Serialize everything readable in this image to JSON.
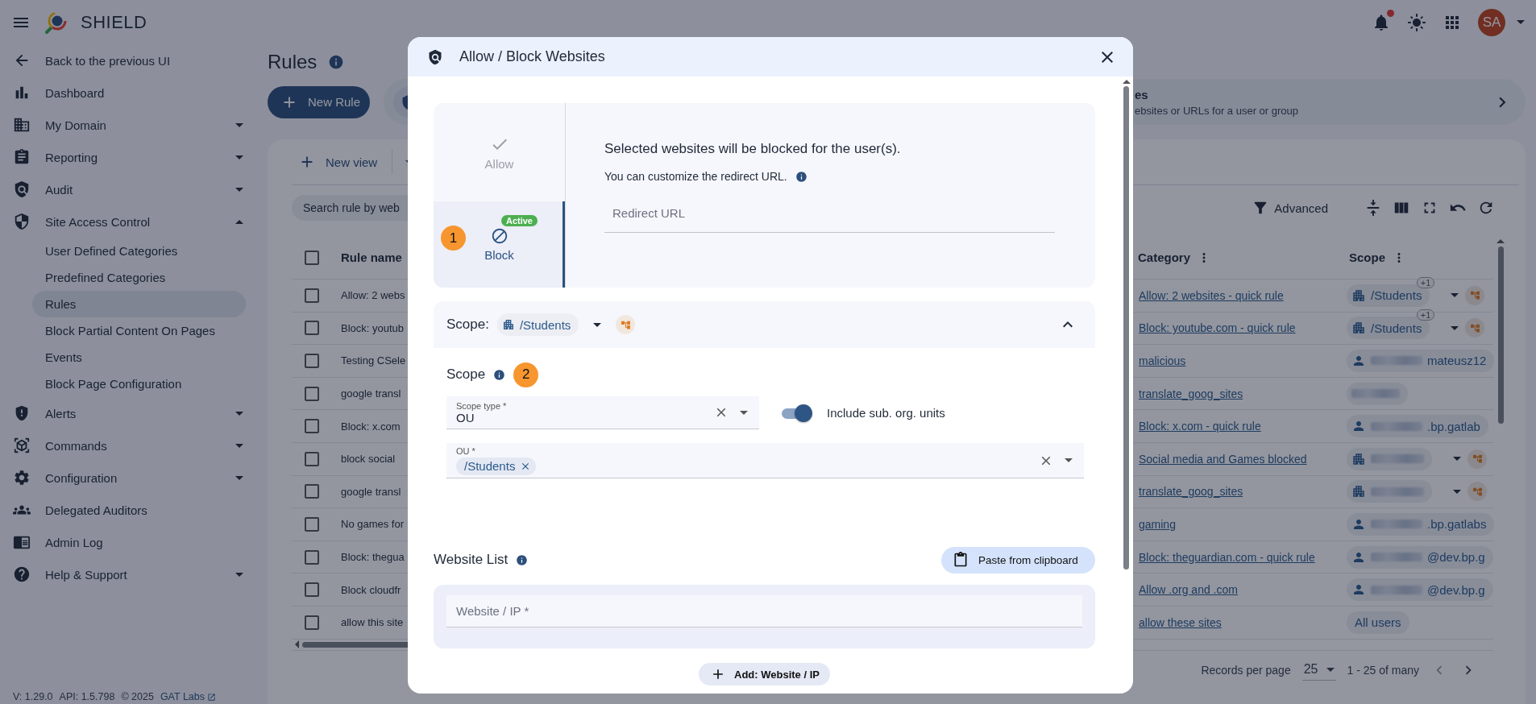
{
  "app": {
    "title": "SHIELD",
    "avatar": "SA",
    "has_notifications": true
  },
  "sidebar": {
    "items": [
      {
        "label": "Back to the previous UI"
      },
      {
        "label": "Dashboard"
      },
      {
        "label": "My Domain",
        "expanded": false
      },
      {
        "label": "Reporting",
        "expanded": false
      },
      {
        "label": "Audit",
        "expanded": false
      },
      {
        "label": "Site Access Control",
        "expanded": true,
        "children": [
          {
            "label": "User Defined Categories",
            "selected": false
          },
          {
            "label": "Predefined Categories",
            "selected": false
          },
          {
            "label": "Rules",
            "selected": true
          },
          {
            "label": "Block Partial Content On Pages",
            "selected": false
          },
          {
            "label": "Events",
            "selected": false
          },
          {
            "label": "Block Page Configuration",
            "selected": false
          }
        ]
      },
      {
        "label": "Alerts",
        "expanded": false
      },
      {
        "label": "Commands",
        "expanded": false
      },
      {
        "label": "Configuration",
        "expanded": false
      },
      {
        "label": "Delegated Auditors"
      },
      {
        "label": "Admin Log"
      },
      {
        "label": "Help & Support",
        "expanded": false
      }
    ],
    "footer": {
      "version": "V: 1.29.0",
      "api": "API: 1.5.798",
      "copyright": "© 2025",
      "link": "GAT Labs"
    }
  },
  "page": {
    "title": "Rules",
    "new_rule": "New Rule",
    "banner": {
      "title": "es",
      "subtitle": "ebsites or URLs for a user or group"
    }
  },
  "table": {
    "new_view": "New view",
    "search_placeholder": "Search rule by web",
    "advanced": "Advanced",
    "select_all_checked": false,
    "columns": [
      "Rule name",
      "Category",
      "Scope"
    ],
    "rows": [
      {
        "name": "Allow: 2 webs",
        "category": "Allow: 2 websites - quick rule",
        "checked": false,
        "scope": {
          "kind": "ou",
          "text": "/Students",
          "extra": "+1",
          "subunits": true
        }
      },
      {
        "name": "Block: youtub",
        "category": "Block: youtube.com - quick rule",
        "checked": false,
        "scope": {
          "kind": "ou",
          "text": "/Students",
          "extra": "+1",
          "subunits": true
        }
      },
      {
        "name": "Testing CSele",
        "category": "malicious",
        "checked": false,
        "scope": {
          "kind": "user",
          "text": "mateusz12"
        }
      },
      {
        "name": "google transl",
        "category": "translate_goog_sites",
        "checked": false,
        "scope": {
          "kind": "redacted"
        }
      },
      {
        "name": "Block: x.com",
        "category": "Block: x.com - quick rule",
        "checked": false,
        "scope": {
          "kind": "user",
          "text": ".bp.gatlab"
        }
      },
      {
        "name": "block social",
        "category": "Social media and Games blocked",
        "checked": false,
        "scope": {
          "kind": "ou",
          "subunits": true
        }
      },
      {
        "name": "google transl",
        "category": "translate_goog_sites",
        "checked": false,
        "scope": {
          "kind": "ou",
          "subunits": true
        }
      },
      {
        "name": "No games for",
        "category": "gaming",
        "checked": false,
        "scope": {
          "kind": "user",
          "text": ".bp.gatlabs"
        }
      },
      {
        "name": "Block: thegua",
        "category": "Block: theguardian.com - quick rule",
        "checked": false,
        "scope": {
          "kind": "user",
          "text": "@dev.bp.g"
        }
      },
      {
        "name": "Block cloudfr",
        "category": "Allow .org and .com",
        "checked": false,
        "scope": {
          "kind": "user",
          "text": "@dev.bp.g"
        }
      },
      {
        "name": "allow this site",
        "category": "allow these sites",
        "checked": false,
        "scope": {
          "kind": "all",
          "text": "All users"
        }
      }
    ],
    "pagination": {
      "label": "Records per page",
      "size": "25",
      "range": "1 - 25 of many"
    }
  },
  "dialog": {
    "title": "Allow / Block Websites",
    "modes": [
      {
        "label": "Allow",
        "selected": false
      },
      {
        "label": "Block",
        "selected": true,
        "badge": "Active",
        "step": "1"
      }
    ],
    "description": "Selected websites will be blocked for the user(s).",
    "redirect_hint": "You can customize the redirect URL.",
    "redirect_placeholder": "Redirect URL",
    "scope": {
      "label": "Scope:",
      "chip": "/Students",
      "expanded": true,
      "section_title": "Scope",
      "step": "2",
      "scope_type_label": "Scope type *",
      "scope_type_value": "OU",
      "include_sub": {
        "label": "Include sub. org. units",
        "on": true
      },
      "ou_label": "OU *",
      "ou_chips": [
        "/Students"
      ]
    },
    "website_list": {
      "title": "Website List",
      "paste": "Paste from clipboard",
      "placeholder": "Website / IP *",
      "add": "Add: Website / IP"
    }
  }
}
